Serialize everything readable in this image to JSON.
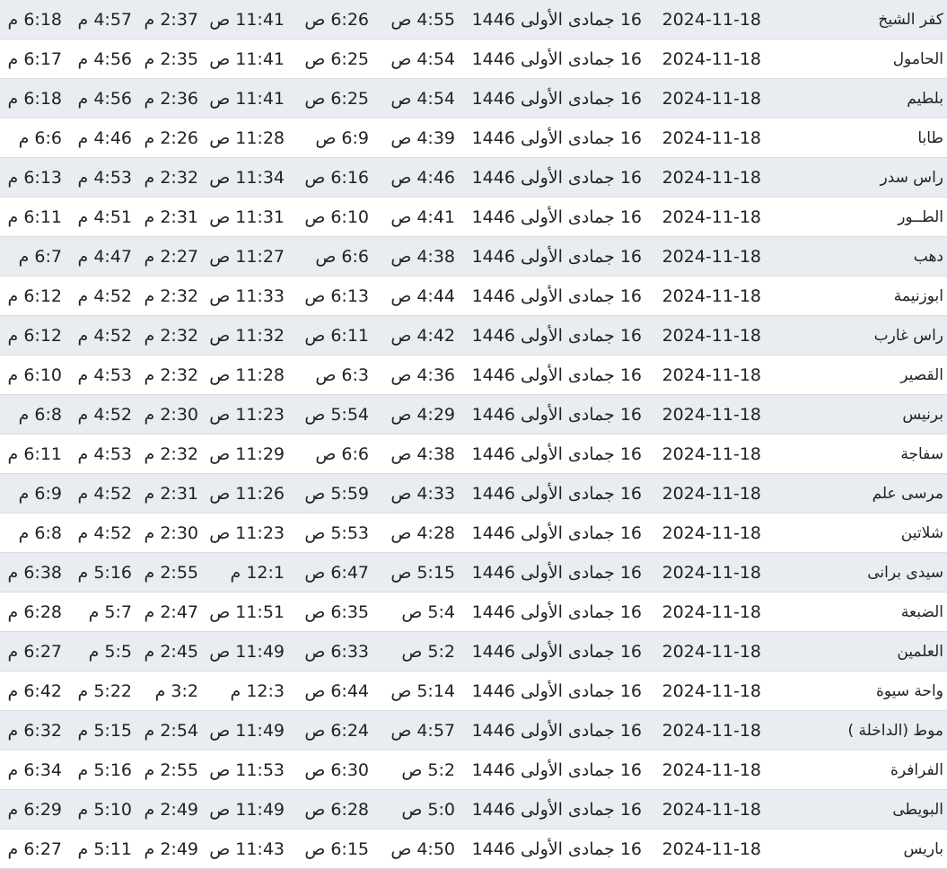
{
  "rows": [
    {
      "city": "كفر الشيخ",
      "date": "2024-11-18",
      "hijri": "16 جمادى الأولى 1446",
      "fajr": "4:55 ص",
      "sunrise": "6:26 ص",
      "dhuhr": "11:41 ص",
      "asr": "2:37 م",
      "maghrib": "4:57 م",
      "isha": "6:18 م"
    },
    {
      "city": "الحامول",
      "date": "2024-11-18",
      "hijri": "16 جمادى الأولى 1446",
      "fajr": "4:54 ص",
      "sunrise": "6:25 ص",
      "dhuhr": "11:41 ص",
      "asr": "2:35 م",
      "maghrib": "4:56 م",
      "isha": "6:17 م"
    },
    {
      "city": "بلطيم",
      "date": "2024-11-18",
      "hijri": "16 جمادى الأولى 1446",
      "fajr": "4:54 ص",
      "sunrise": "6:25 ص",
      "dhuhr": "11:41 ص",
      "asr": "2:36 م",
      "maghrib": "4:56 م",
      "isha": "6:18 م"
    },
    {
      "city": "طابا",
      "date": "2024-11-18",
      "hijri": "16 جمادى الأولى 1446",
      "fajr": "4:39 ص",
      "sunrise": "6:9 ص",
      "dhuhr": "11:28 ص",
      "asr": "2:26 م",
      "maghrib": "4:46 م",
      "isha": "6:6 م"
    },
    {
      "city": "راس سدر",
      "date": "2024-11-18",
      "hijri": "16 جمادى الأولى 1446",
      "fajr": "4:46 ص",
      "sunrise": "6:16 ص",
      "dhuhr": "11:34 ص",
      "asr": "2:32 م",
      "maghrib": "4:53 م",
      "isha": "6:13 م"
    },
    {
      "city": "الطــور",
      "date": "2024-11-18",
      "hijri": "16 جمادى الأولى 1446",
      "fajr": "4:41 ص",
      "sunrise": "6:10 ص",
      "dhuhr": "11:31 ص",
      "asr": "2:31 م",
      "maghrib": "4:51 م",
      "isha": "6:11 م"
    },
    {
      "city": "دهب",
      "date": "2024-11-18",
      "hijri": "16 جمادى الأولى 1446",
      "fajr": "4:38 ص",
      "sunrise": "6:6 ص",
      "dhuhr": "11:27 ص",
      "asr": "2:27 م",
      "maghrib": "4:47 م",
      "isha": "6:7 م"
    },
    {
      "city": "ابوزنيمة",
      "date": "2024-11-18",
      "hijri": "16 جمادى الأولى 1446",
      "fajr": "4:44 ص",
      "sunrise": "6:13 ص",
      "dhuhr": "11:33 ص",
      "asr": "2:32 م",
      "maghrib": "4:52 م",
      "isha": "6:12 م"
    },
    {
      "city": "راس غارب",
      "date": "2024-11-18",
      "hijri": "16 جمادى الأولى 1446",
      "fajr": "4:42 ص",
      "sunrise": "6:11 ص",
      "dhuhr": "11:32 ص",
      "asr": "2:32 م",
      "maghrib": "4:52 م",
      "isha": "6:12 م"
    },
    {
      "city": "القصير",
      "date": "2024-11-18",
      "hijri": "16 جمادى الأولى 1446",
      "fajr": "4:36 ص",
      "sunrise": "6:3 ص",
      "dhuhr": "11:28 ص",
      "asr": "2:32 م",
      "maghrib": "4:53 م",
      "isha": "6:10 م"
    },
    {
      "city": "برنيس",
      "date": "2024-11-18",
      "hijri": "16 جمادى الأولى 1446",
      "fajr": "4:29 ص",
      "sunrise": "5:54 ص",
      "dhuhr": "11:23 ص",
      "asr": "2:30 م",
      "maghrib": "4:52 م",
      "isha": "6:8 م"
    },
    {
      "city": "سفاجة",
      "date": "2024-11-18",
      "hijri": "16 جمادى الأولى 1446",
      "fajr": "4:38 ص",
      "sunrise": "6:6 ص",
      "dhuhr": "11:29 ص",
      "asr": "2:32 م",
      "maghrib": "4:53 م",
      "isha": "6:11 م"
    },
    {
      "city": "مرسى علم",
      "date": "2024-11-18",
      "hijri": "16 جمادى الأولى 1446",
      "fajr": "4:33 ص",
      "sunrise": "5:59 ص",
      "dhuhr": "11:26 ص",
      "asr": "2:31 م",
      "maghrib": "4:52 م",
      "isha": "6:9 م"
    },
    {
      "city": "شلاتين",
      "date": "2024-11-18",
      "hijri": "16 جمادى الأولى 1446",
      "fajr": "4:28 ص",
      "sunrise": "5:53 ص",
      "dhuhr": "11:23 ص",
      "asr": "2:30 م",
      "maghrib": "4:52 م",
      "isha": "6:8 م"
    },
    {
      "city": "سيدى برانى",
      "date": "2024-11-18",
      "hijri": "16 جمادى الأولى 1446",
      "fajr": "5:15 ص",
      "sunrise": "6:47 ص",
      "dhuhr": "12:1 م",
      "asr": "2:55 م",
      "maghrib": "5:16 م",
      "isha": "6:38 م"
    },
    {
      "city": "الضبعة",
      "date": "2024-11-18",
      "hijri": "16 جمادى الأولى 1446",
      "fajr": "5:4 ص",
      "sunrise": "6:35 ص",
      "dhuhr": "11:51 ص",
      "asr": "2:47 م",
      "maghrib": "5:7 م",
      "isha": "6:28 م"
    },
    {
      "city": "العلمين",
      "date": "2024-11-18",
      "hijri": "16 جمادى الأولى 1446",
      "fajr": "5:2 ص",
      "sunrise": "6:33 ص",
      "dhuhr": "11:49 ص",
      "asr": "2:45 م",
      "maghrib": "5:5 م",
      "isha": "6:27 م"
    },
    {
      "city": "واحة سيوة",
      "date": "2024-11-18",
      "hijri": "16 جمادى الأولى 1446",
      "fajr": "5:14 ص",
      "sunrise": "6:44 ص",
      "dhuhr": "12:3 م",
      "asr": "3:2 م",
      "maghrib": "5:22 م",
      "isha": "6:42 م"
    },
    {
      "city": "موط (الداخلة )",
      "date": "2024-11-18",
      "hijri": "16 جمادى الأولى 1446",
      "fajr": "4:57 ص",
      "sunrise": "6:24 ص",
      "dhuhr": "11:49 ص",
      "asr": "2:54 م",
      "maghrib": "5:15 م",
      "isha": "6:32 م"
    },
    {
      "city": "الفرافرة",
      "date": "2024-11-18",
      "hijri": "16 جمادى الأولى 1446",
      "fajr": "5:2 ص",
      "sunrise": "6:30 ص",
      "dhuhr": "11:53 ص",
      "asr": "2:55 م",
      "maghrib": "5:16 م",
      "isha": "6:34 م"
    },
    {
      "city": "البويطى",
      "date": "2024-11-18",
      "hijri": "16 جمادى الأولى 1446",
      "fajr": "5:0 ص",
      "sunrise": "6:28 ص",
      "dhuhr": "11:49 ص",
      "asr": "2:49 م",
      "maghrib": "5:10 م",
      "isha": "6:29 م"
    },
    {
      "city": "باريس",
      "date": "2024-11-18",
      "hijri": "16 جمادى الأولى 1446",
      "fajr": "4:50 ص",
      "sunrise": "6:15 ص",
      "dhuhr": "11:43 ص",
      "asr": "2:49 م",
      "maghrib": "5:11 م",
      "isha": "6:27 م"
    }
  ]
}
